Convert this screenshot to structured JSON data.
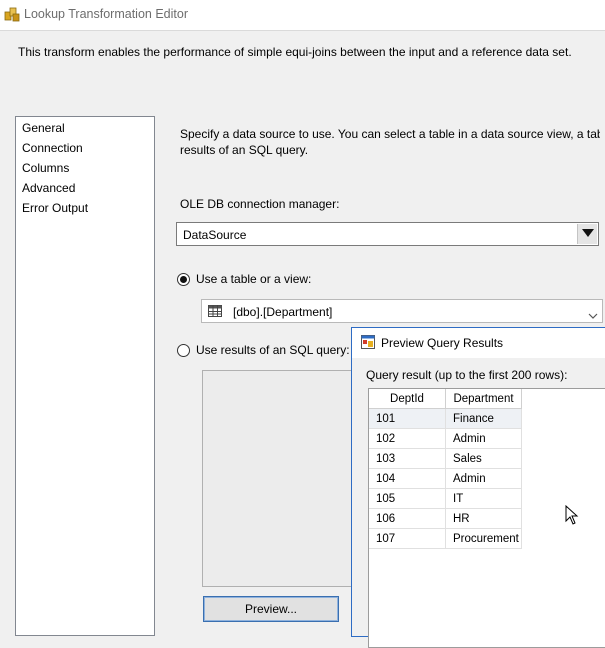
{
  "window": {
    "title": "Lookup Transformation Editor",
    "description": "This transform enables the performance of simple equi-joins between the input and a reference data set."
  },
  "nav": {
    "items": [
      "General",
      "Connection",
      "Columns",
      "Advanced",
      "Error Output"
    ],
    "selected": "Connection"
  },
  "main": {
    "instruction_line1": "Specify a data source to use. You can select a table in a data source view, a table i",
    "instruction_line2": "results of an SQL query.",
    "connection_label": "OLE DB connection manager:",
    "connection_value": "DataSource",
    "radio_table_label": "Use a table or a view:",
    "radio_table_selected": true,
    "table_value": "[dbo].[Department]",
    "radio_sql_label": "Use results of an SQL query:",
    "preview_button": "Preview..."
  },
  "preview_window": {
    "title": "Preview Query Results",
    "caption": "Query result (up to the first 200 rows):",
    "columns": [
      "DeptId",
      "Department"
    ],
    "rows": [
      [
        "101",
        "Finance"
      ],
      [
        "102",
        "Admin"
      ],
      [
        "103",
        "Sales"
      ],
      [
        "104",
        "Admin"
      ],
      [
        "105",
        "IT"
      ],
      [
        "106",
        "HR"
      ],
      [
        "107",
        "Procurement"
      ]
    ]
  },
  "colors": {
    "accent_border": "#2e6cc4",
    "selected_cell": "#eef1f5"
  }
}
